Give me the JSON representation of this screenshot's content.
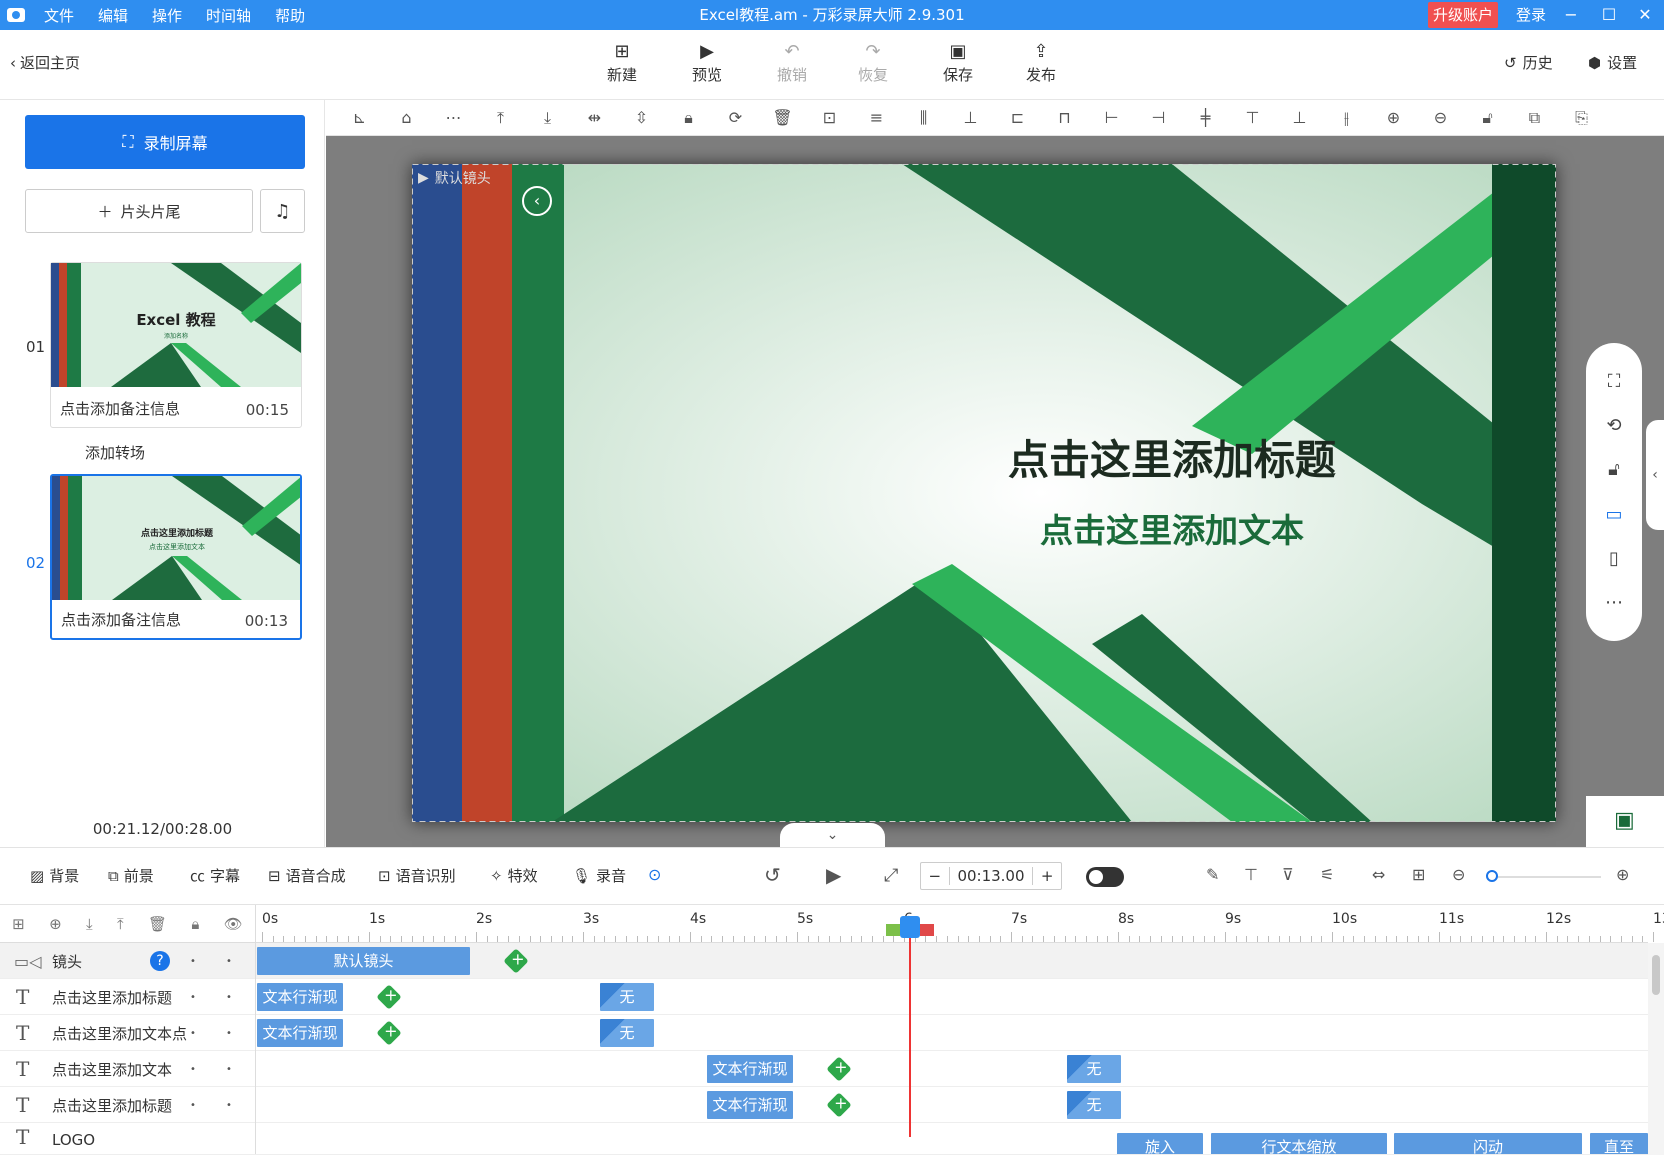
{
  "titlebar": {
    "menu": [
      "文件",
      "编辑",
      "操作",
      "时间轴",
      "帮助"
    ],
    "title": "Excel教程.am - 万彩录屏大师 2.9.301",
    "upgrade": "升级账户",
    "login": "登录"
  },
  "toolbar": {
    "back": "返回主页",
    "buttons": [
      {
        "label": "新建",
        "icon": "plus-square-icon"
      },
      {
        "label": "预览",
        "icon": "play-icon"
      },
      {
        "label": "撤销",
        "icon": "undo-icon"
      },
      {
        "label": "恢复",
        "icon": "redo-icon"
      },
      {
        "label": "保存",
        "icon": "save-icon"
      },
      {
        "label": "发布",
        "icon": "publish-icon"
      }
    ],
    "history": "历史",
    "settings": "设置"
  },
  "sidebar": {
    "record": "录制屏幕",
    "clip": "片头片尾",
    "scenes": [
      {
        "num": "01",
        "note": "点击添加备注信息",
        "duration": "00:15",
        "thumb_title": "Excel 教程",
        "thumb_sub": "添加名称"
      },
      {
        "num": "02",
        "note": "点击添加备注信息",
        "duration": "00:13",
        "thumb_title": "点击这里添加标题",
        "thumb_sub": "点击这里添加文本"
      }
    ],
    "transition": "添加转场",
    "elapsed": "00:21.12/00:28.00"
  },
  "canvas": {
    "camera_label": "默认镜头",
    "title": "点击这里添加标题",
    "subtitle": "点击这里添加文本"
  },
  "controls": {
    "items": [
      "背景",
      "前景",
      "字幕",
      "语音合成",
      "语音识别",
      "特效",
      "录音"
    ],
    "time": "00:13.00",
    "minus": "−",
    "plus": "+"
  },
  "timeline": {
    "ticks": [
      "0s",
      "1s",
      "2s",
      "3s",
      "4s",
      "5s",
      "6",
      "7s",
      "8s",
      "9s",
      "10s",
      "11s",
      "12s",
      "13s"
    ],
    "camera_row": {
      "name": "镜头",
      "block": "默认镜头"
    },
    "rows": [
      {
        "name": "点击这里添加标题",
        "a": "文本行渐现",
        "b": "无"
      },
      {
        "name": "点击这里添加文本点",
        "a": "文本行渐现",
        "b": "无"
      },
      {
        "name": "点击这里添加文本",
        "a": "文本行渐现",
        "b": "无"
      },
      {
        "name": "点击这里添加标题",
        "a": "文本行渐现",
        "b": "无"
      }
    ],
    "partial_row": {
      "name": "LOGO",
      "blocks": [
        "旋入",
        "行文本缩放",
        "闪动",
        "直至"
      ]
    }
  },
  "colors": {
    "accent": "#2f8ef0",
    "record": "#1a74e8",
    "upgrade": "#f05050",
    "green": "#1a6b3a"
  }
}
